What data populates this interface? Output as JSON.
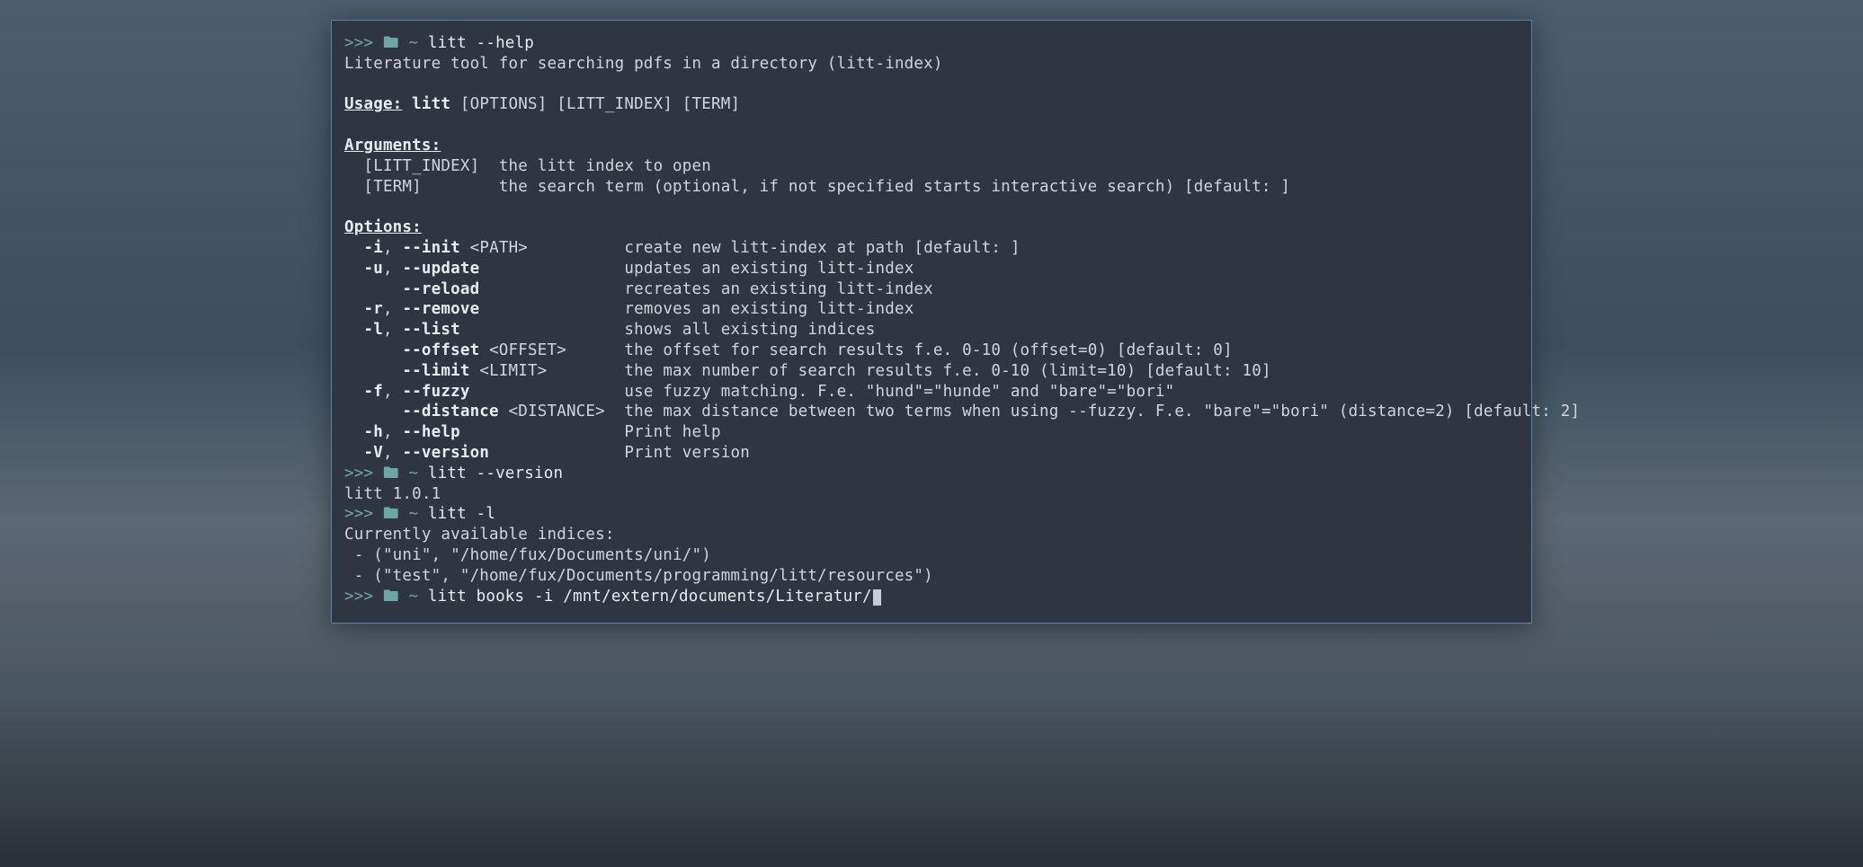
{
  "prompt_arrows": ">>>",
  "folder_icon": "🖿",
  "tilde": "~",
  "cmd1": "litt --help",
  "help": {
    "desc": "Literature tool for searching pdfs in a directory (litt-index)",
    "usage_label": "Usage:",
    "usage_cmd": "litt",
    "usage_rest": "[OPTIONS] [LITT_INDEX] [TERM]",
    "arguments_label": "Arguments:",
    "arg1_name": "[LITT_INDEX]",
    "arg1_desc": "the litt index to open",
    "arg2_name": "[TERM]",
    "arg2_desc": "the search term (optional, if not specified starts interactive search) [default: ]",
    "options_label": "Options:",
    "opt_init_short": "-i",
    "opt_init_long": "--init",
    "opt_init_arg": "<PATH>",
    "opt_init_desc": "create new litt-index at path [default: ]",
    "opt_update_short": "-u",
    "opt_update_long": "--update",
    "opt_update_desc": "updates an existing litt-index",
    "opt_reload_long": "--reload",
    "opt_reload_desc": "recreates an existing litt-index",
    "opt_remove_short": "-r",
    "opt_remove_long": "--remove",
    "opt_remove_desc": "removes an existing litt-index",
    "opt_list_short": "-l",
    "opt_list_long": "--list",
    "opt_list_desc": "shows all existing indices",
    "opt_offset_long": "--offset",
    "opt_offset_arg": "<OFFSET>",
    "opt_offset_desc": "the offset for search results f.e. 0-10 (offset=0) [default: 0]",
    "opt_limit_long": "--limit",
    "opt_limit_arg": "<LIMIT>",
    "opt_limit_desc": "the max number of search results f.e. 0-10 (limit=10) [default: 10]",
    "opt_fuzzy_short": "-f",
    "opt_fuzzy_long": "--fuzzy",
    "opt_fuzzy_desc": "use fuzzy matching. F.e. \"hund\"=\"hunde\" and \"bare\"=\"bori\"",
    "opt_distance_long": "--distance",
    "opt_distance_arg": "<DISTANCE>",
    "opt_distance_desc": "the max distance between two terms when using --fuzzy. F.e. \"bare\"=\"bori\" (distance=2) [default: 2]",
    "opt_help_short": "-h",
    "opt_help_long": "--help",
    "opt_help_desc": "Print help",
    "opt_version_short": "-V",
    "opt_version_long": "--version",
    "opt_version_desc": "Print version"
  },
  "cmd2": "litt --version",
  "version_output": "litt 1.0.1",
  "cmd3": "litt -l",
  "list_output": {
    "header": "Currently available indices:",
    "row1": " - (\"uni\", \"/home/fux/Documents/uni/\")",
    "row2": " - (\"test\", \"/home/fux/Documents/programming/litt/resources\")"
  },
  "cmd4": "litt books -i /mnt/extern/documents/Literatur/"
}
